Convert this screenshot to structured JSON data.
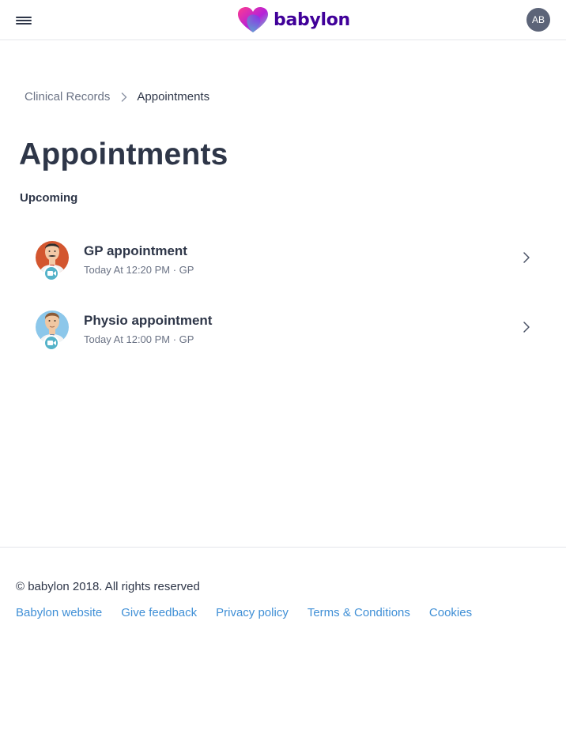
{
  "header": {
    "logo_text": "babylon",
    "avatar_initials": "AB",
    "icons": {
      "menu": "hamburger-menu-icon",
      "logo": "babylon-heart-logo"
    }
  },
  "breadcrumb": {
    "parent": "Clinical Records",
    "current": "Appointments"
  },
  "page": {
    "title": "Appointments",
    "section": "Upcoming"
  },
  "appointments": [
    {
      "title": "GP appointment",
      "time": "Today At 12:20 PM",
      "type": "GP",
      "meta": "Today At 12:20 PM · GP",
      "avatar": "male-doctor-avatar-red",
      "badge": "video-camera-icon"
    },
    {
      "title": "Physio appointment",
      "time": "Today At 12:00 PM",
      "type": "GP",
      "meta": "Today At 12:00 PM · GP",
      "avatar": "male-doctor-avatar-blue",
      "badge": "video-camera-icon"
    }
  ],
  "footer": {
    "copyright": "© babylon 2018. All rights reserved",
    "links": [
      "Babylon website",
      "Give feedback",
      "Privacy policy",
      "Terms & Conditions",
      "Cookies"
    ]
  },
  "colors": {
    "brand_purple": "#400099",
    "text_dark": "#2e3648",
    "text_muted": "#6b7385",
    "link_blue": "#3f8fd6",
    "avatar_bg": "#5c6478",
    "video_badge": "#55b3c9",
    "avatar1_bg": "#d3562f",
    "avatar2_bg": "#8cc7ea"
  }
}
